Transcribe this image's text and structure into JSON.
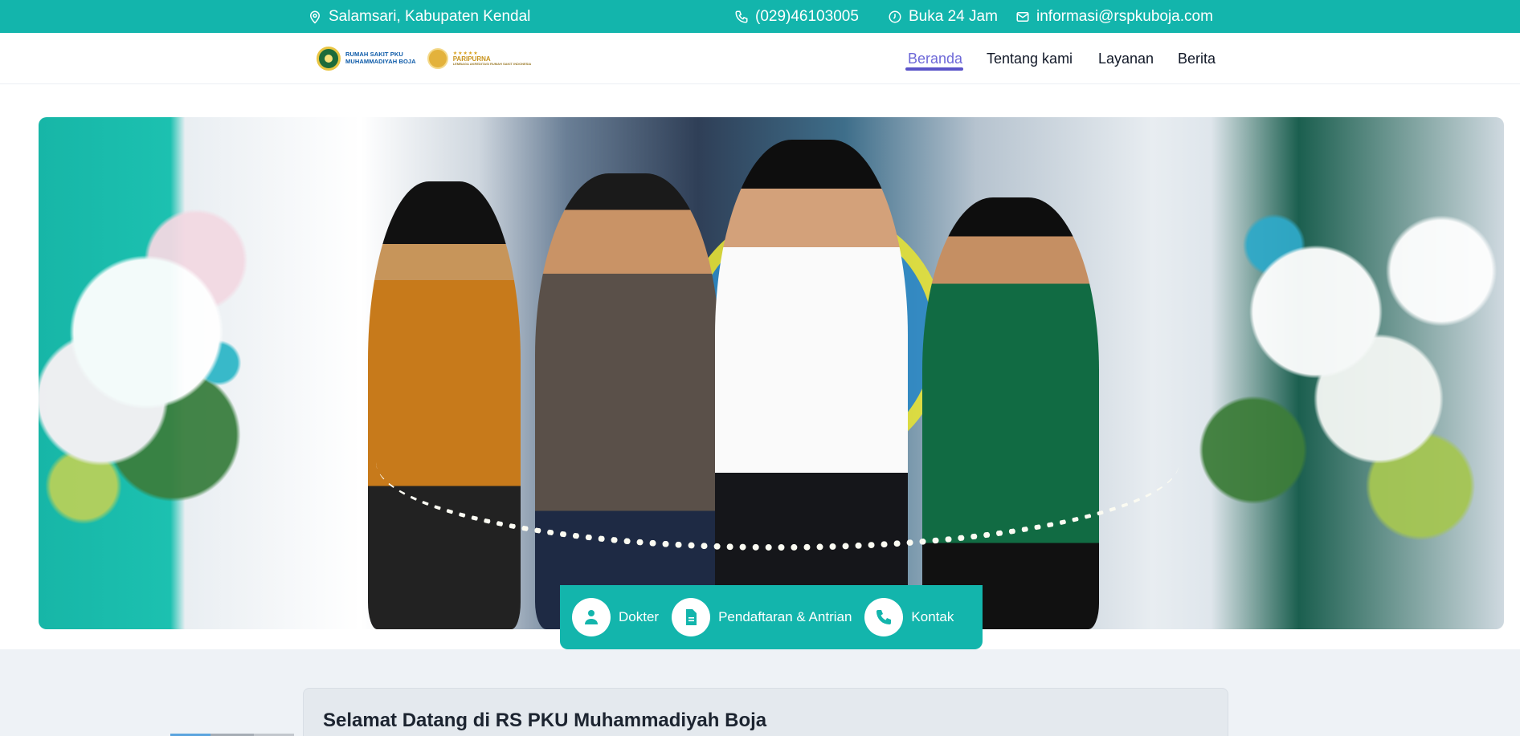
{
  "topbar": {
    "location": "Salamsari, Kabupaten Kendal",
    "phone": "(029)46103005",
    "hours": "Buka 24 Jam",
    "email": "informasi@rspkuboja.com"
  },
  "logo": {
    "line1": "RUMAH SAKIT PKU",
    "line2": "MUHAMMADIYAH BOJA",
    "badge_title": "PARIPURNA",
    "badge_stars": "★★★★★",
    "badge_sub": "LEMBAGA AKREDITASI RUMAH SAKIT INDONESIA"
  },
  "nav": {
    "items": [
      {
        "label": "Beranda",
        "active": true
      },
      {
        "label": "Tentang kami",
        "active": false
      },
      {
        "label": "Layanan",
        "active": false
      },
      {
        "label": "Berita",
        "active": false
      }
    ]
  },
  "quick_actions": [
    {
      "label": "Dokter",
      "icon": "doctor-icon"
    },
    {
      "label": "Pendaftaran & Antrian",
      "icon": "document-icon"
    },
    {
      "label": "Kontak",
      "icon": "phone-icon"
    }
  ],
  "welcome": {
    "title": "Selamat Datang di RS PKU Muhammadiyah Boja"
  },
  "colors": {
    "primary": "#13b5ac",
    "nav_active": "#6d68d8"
  }
}
